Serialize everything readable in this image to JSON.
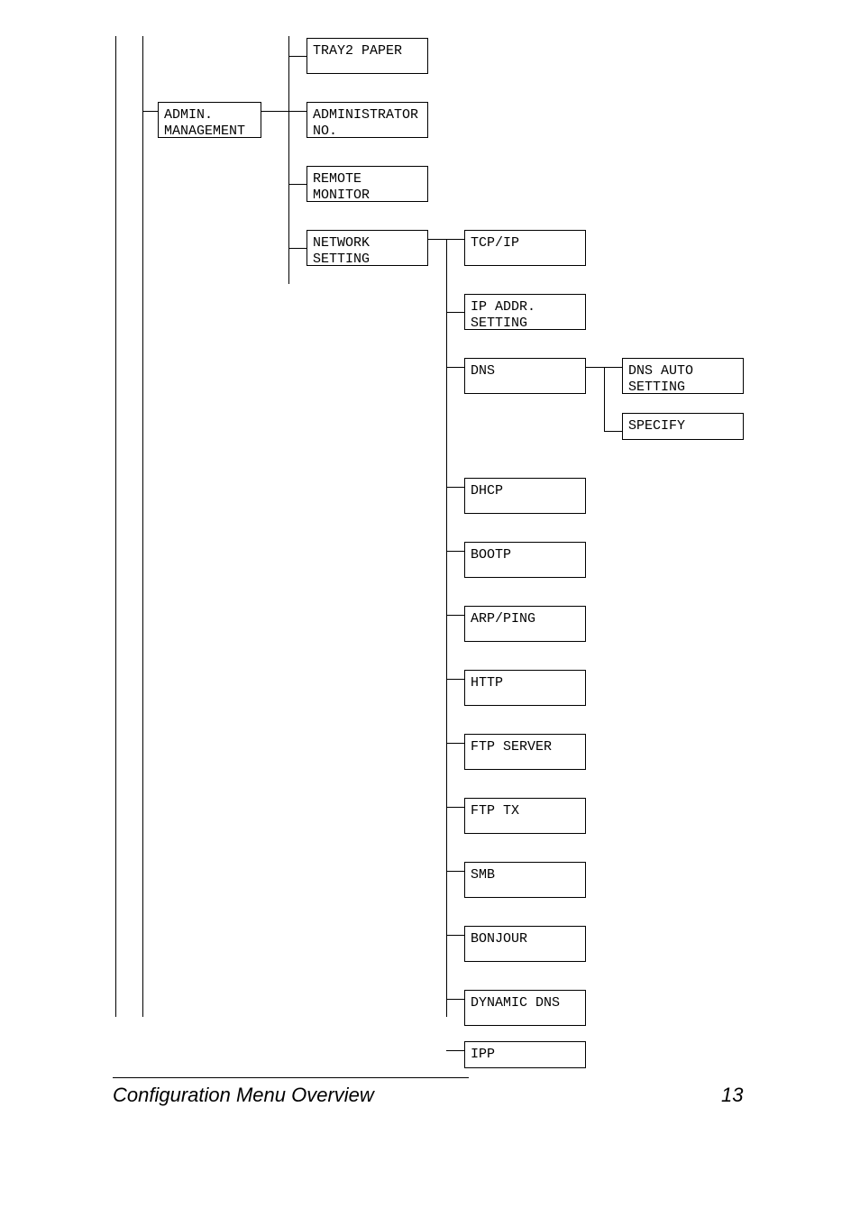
{
  "nodes": {
    "tray2": "TRAY2 PAPER",
    "admin": "ADMIN.\nMANAGEMENT",
    "adminno": "ADMINISTRATOR\nNO.",
    "remote": "REMOTE\nMONITOR",
    "network": "NETWORK\nSETTING",
    "tcpip": "TCP/IP",
    "ipaddr": "IP ADDR.\nSETTING",
    "dns": "DNS",
    "dnsauto": "DNS AUTO\nSETTING",
    "specify": "SPECIFY",
    "dhcp": "DHCP",
    "bootp": "BOOTP",
    "arpping": "ARP/PING",
    "http": "HTTP",
    "ftpserver": "FTP SERVER",
    "ftptx": "FTP TX",
    "smb": "SMB",
    "bonjour": "BONJOUR",
    "dyndns": "DYNAMIC DNS",
    "ipp": "IPP"
  },
  "footer": {
    "title": "Configuration Menu Overview",
    "page": "13"
  }
}
